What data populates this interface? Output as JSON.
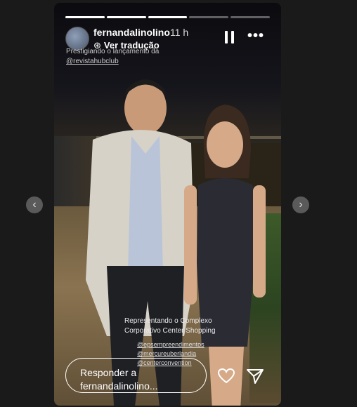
{
  "story": {
    "username": "fernandalinolino",
    "time": "11 h",
    "translate_glyph": "⊛",
    "translate_label": "Ver tradução",
    "caption_line1": "Prestigiando o lançamento da",
    "caption_line2": "@revistahubclub",
    "overlay_line1": "Representando o Complexo",
    "overlay_line2": "Corporativo Center Shopping",
    "tags": [
      "@epsempreendimentos",
      "@mercureuberlandia",
      "@centerconvention"
    ],
    "progress": [
      1,
      1,
      1,
      0,
      0
    ]
  },
  "reply": {
    "line1": "Responder a",
    "line2": "fernandalinolino..."
  },
  "icons": {
    "pause": "pause-icon",
    "more": "more-icon",
    "heart": "heart-icon",
    "share": "share-icon",
    "prev": "chevron-left-icon",
    "next": "chevron-right-icon"
  },
  "nav": {
    "prev": "‹",
    "next": "›"
  },
  "more_glyph": "•••"
}
